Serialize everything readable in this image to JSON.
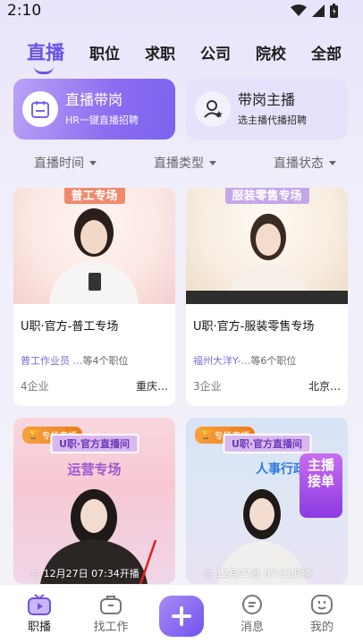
{
  "status": {
    "time": "2:10"
  },
  "topnav": {
    "tabs": [
      {
        "label": "直播"
      },
      {
        "label": "职位"
      },
      {
        "label": "求职"
      },
      {
        "label": "公司"
      },
      {
        "label": "院校"
      },
      {
        "label": "全部"
      }
    ]
  },
  "features": {
    "live_with_post": {
      "title": "直播带岗",
      "subtitle": "HR一键直播招聘"
    },
    "host": {
      "title": "带岗主播",
      "subtitle": "选主播代播招聘"
    }
  },
  "filters": [
    {
      "label": "直播时间"
    },
    {
      "label": "直播类型"
    },
    {
      "label": "直播状态"
    }
  ],
  "cards": [
    {
      "banner": "普工专场",
      "title": "U职·官方-普工专场",
      "jobs": "普工作业员 …",
      "more": "等4个职位",
      "companies": "4企业",
      "city": "重庆…"
    },
    {
      "banner": "服装零售专场",
      "title": "U职·官方-服装零售专场",
      "jobs": "福州大洋Y-…",
      "more": "等6个职位",
      "companies": "3企业",
      "city": "北京…"
    },
    {
      "badge": "专场直播",
      "banner_top": "U职·官方直播间",
      "banner": "运营专场",
      "time": "12月27日 07:34开播"
    },
    {
      "badge": "专场直播",
      "banner_top": "U职·官方直播间",
      "banner": "人事行政专场",
      "sticker": "主播接单",
      "time": "12月27日 07:31开播"
    }
  ],
  "bottomnav": {
    "items": [
      {
        "label": "职播"
      },
      {
        "label": "找工作"
      },
      {
        "label": "消息"
      },
      {
        "label": "我的"
      }
    ]
  },
  "colors": {
    "accent": "#6b53e8",
    "jobs_text": "#7a6dd9"
  }
}
